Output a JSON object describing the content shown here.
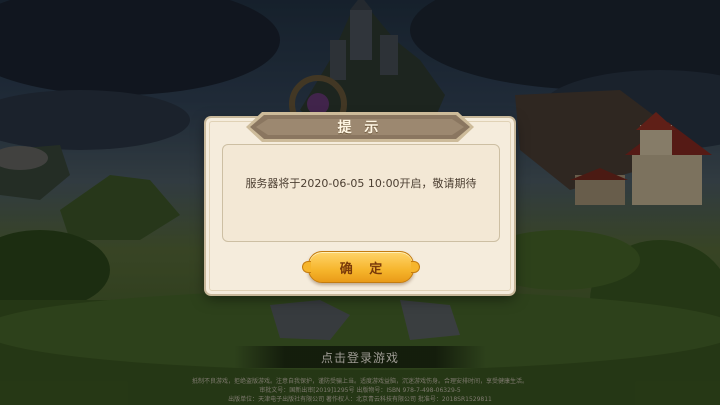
{
  "dialog": {
    "title": "提 示",
    "message": "服务器将于2020-06-05  10:00开启，敬请期待",
    "confirm_label": "确 定"
  },
  "login": {
    "label": "点击登录游戏"
  },
  "footer": {
    "line1": "抵制不良游戏，拒绝盗版游戏。注意自我保护，谨防受骗上当。适度游戏益脑，沉迷游戏伤身。合理安排时间，享受健康生活。",
    "line2": "审批文号：国新出审[2019]1295号  出版物号：ISBN 978-7-498-06329-5",
    "line3": "出版单位：天津电子出版社有限公司  著作权人：北京青云科技有限公司  批准号：2018SR1529811"
  },
  "colors": {
    "dialog_bg": "#f5ecdc",
    "banner": "#8a7660",
    "button": "#f6b52c",
    "message_text": "#4c3f32"
  }
}
